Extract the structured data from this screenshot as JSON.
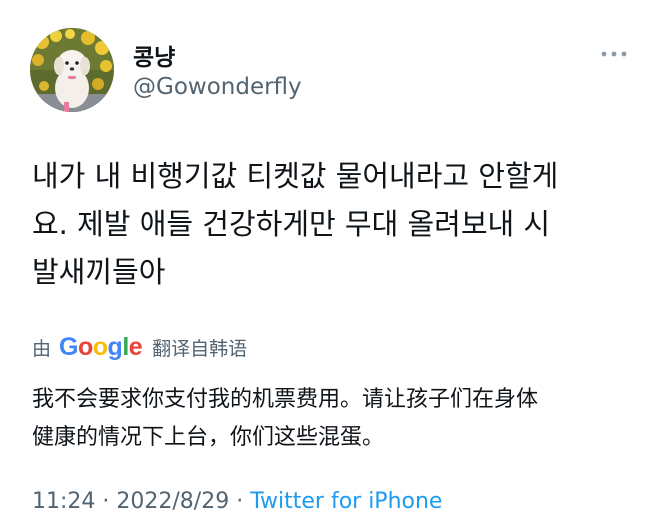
{
  "user": {
    "display_name": "콩냥",
    "handle": "@Gowonderfly",
    "avatar_icon": "dog-photo-avatar"
  },
  "tweet": {
    "text": "내가 내 비행기값 티켓값 물어내라고 안할게\n요. 제발 애들 건강하게만 무대 올려보내 시\n발새끼들아"
  },
  "translation": {
    "by_label": "由",
    "provider": "Google",
    "action_label": "翻译自韩语",
    "translated_text": "我不会要求你支付我的机票费用。请让孩子们在身体\n健康的情况下上台，你们这些混蛋。"
  },
  "meta": {
    "time": "11:24",
    "separator": "·",
    "date": "2022/8/29",
    "source": "Twitter for iPhone"
  },
  "colors": {
    "primary_text": "#0f1419",
    "secondary_text": "#536471",
    "link": "#1d9bf0"
  },
  "icons": {
    "more": "more-horizontal-icon"
  }
}
